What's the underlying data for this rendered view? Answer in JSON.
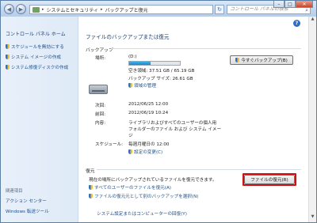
{
  "titlebar": {
    "back_glyph": "◀",
    "forward_glyph": "▶",
    "breadcrumb": [
      "システムとセキュリティ",
      "バックアップと復元"
    ],
    "separator": "▸",
    "refresh_glyph": "↻",
    "search_placeholder": "コントロール パネルの検索",
    "search_glyph": "⌕",
    "minimize_glyph": "–",
    "maximize_glyph": "□",
    "close_glyph": "✕"
  },
  "sidebar": {
    "title": "コントロール パネル ホーム",
    "items": [
      {
        "label": "スケジュールを無効にする"
      },
      {
        "label": "システム イメージの作成"
      },
      {
        "label": "システム修復ディスクの作成"
      }
    ],
    "related_title": "関連項目",
    "bottom_items": [
      {
        "label": "アクション センター"
      },
      {
        "label": "Windows 転送ツール"
      }
    ]
  },
  "main": {
    "help_glyph": "?",
    "page_title": "ファイルのバックアップまたは復元",
    "backup": {
      "section": "バックアップ",
      "location_label": "場所:",
      "drive": "(D:)",
      "free_space": "空き領域: 37.51 GB / 65.19 GB",
      "usage_fraction": 0.42,
      "backup_size": "バックアップ サイズ: 26.61 GB",
      "manage_space": "領域の管理",
      "backup_now": "今すぐバックアップ(B)",
      "next_label": "次回:",
      "next_value": "2012/06/25 12:00",
      "last_label": "前回:",
      "last_value": "2012/06/19 10:24",
      "contents_label": "内容:",
      "contents_value_1": "ライブラリおよびすべてのユーザーの個人用",
      "contents_value_2": "フォルダーのファイル および システム イメー",
      "contents_value_3": "ジ",
      "schedule_label": "スケジュール:",
      "schedule_value": "毎週月曜日の 12:00",
      "change_settings": "設定の変更(C)"
    },
    "restore": {
      "section": "復元",
      "description": "現在の場所にバックアップされているファイルを復元できます。",
      "restore_button": "ファイルの復元(R)",
      "all_users": "すべてのユーザーのファイルを復元(A)",
      "select_other": "ファイルの復元元として別のバックアップを選択(N)",
      "recover_link": "システム設定またはコンピューターの回復(Y)"
    }
  },
  "colors": {
    "highlight": "#d01010",
    "link": "#1a4e8c"
  }
}
